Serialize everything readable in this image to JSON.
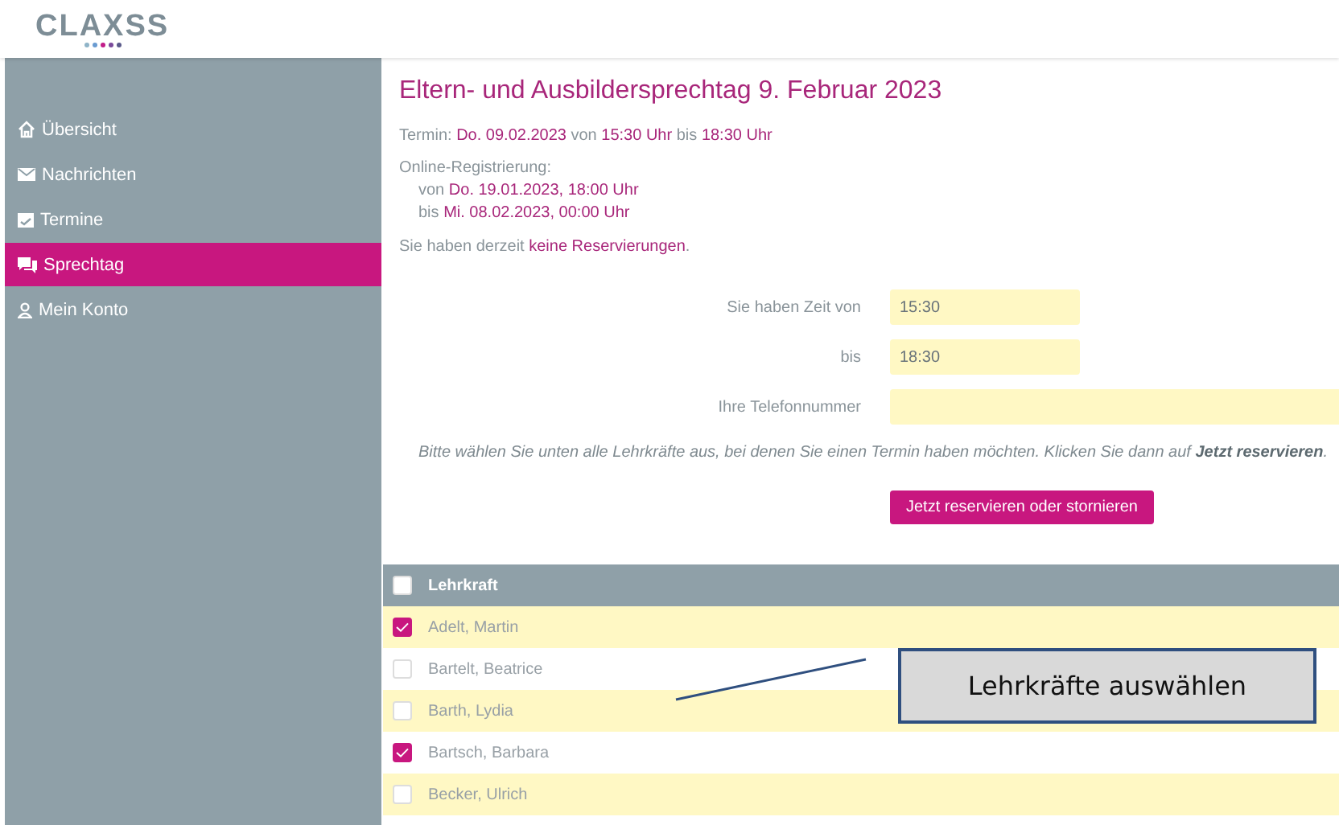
{
  "logo": {
    "text": "CLAXSS"
  },
  "sidebar": {
    "items": [
      {
        "label": "Übersicht",
        "selected": false
      },
      {
        "label": "Nachrichten",
        "selected": false
      },
      {
        "label": "Termine",
        "selected": false
      },
      {
        "label": "Sprechtag",
        "selected": true
      },
      {
        "label": "Mein Konto",
        "selected": false
      }
    ]
  },
  "main": {
    "title": "Eltern- und Ausbildersprechtag 9. Februar 2023",
    "termin": [
      {
        "text": "Termin:",
        "highlight": false
      },
      {
        "text": "Do. 09.02.2023",
        "highlight": true
      },
      {
        "text": "von",
        "highlight": false
      },
      {
        "text": "15:30 Uhr",
        "highlight": true
      },
      {
        "text": "bis",
        "highlight": false
      },
      {
        "text": "18:30 Uhr",
        "highlight": true
      }
    ],
    "registration_label": "Online-Registrierung:",
    "registration_from": [
      {
        "text": "von",
        "highlight": false
      },
      {
        "text": "Do. 19.01.2023, 18:00 Uhr",
        "highlight": true
      }
    ],
    "registration_to": [
      {
        "text": "bis",
        "highlight": false
      },
      {
        "text": "Mi. 08.02.2023, 00:00 Uhr",
        "highlight": true
      }
    ],
    "reservations": [
      {
        "text": "Sie haben derzeit",
        "highlight": false
      },
      {
        "text": "keine Reservierungen",
        "highlight": true
      },
      {
        "text": ".",
        "highlight": false,
        "attached": true
      }
    ],
    "form": [
      {
        "label": "Sie haben Zeit von",
        "value": "15:30",
        "kind": "time"
      },
      {
        "label": "bis",
        "value": "18:30",
        "kind": "time"
      },
      {
        "label": "Ihre Telefonnummer",
        "kind": "phone"
      }
    ],
    "hint": "Bitte wählen Sie unten alle Lehrkräfte aus, bei denen Sie einen Termin haben möchten. Klicken Sie dann auf **Jetzt reservieren**.",
    "submit_button": "Jetzt reservieren oder stornieren"
  },
  "table": {
    "header": {
      "label": "Lehrkraft",
      "checked": false
    },
    "rows": [
      {
        "name": "Adelt, Martin",
        "checked": true
      },
      {
        "name": "Bartelt, Beatrice",
        "checked": false
      },
      {
        "name": "Barth, Lydia",
        "checked": false
      },
      {
        "name": "Bartsch, Barbara",
        "checked": true
      },
      {
        "name": "Becker, Ulrich",
        "checked": false
      }
    ]
  },
  "callout": {
    "text": "Lehrkräfte auswählen"
  }
}
